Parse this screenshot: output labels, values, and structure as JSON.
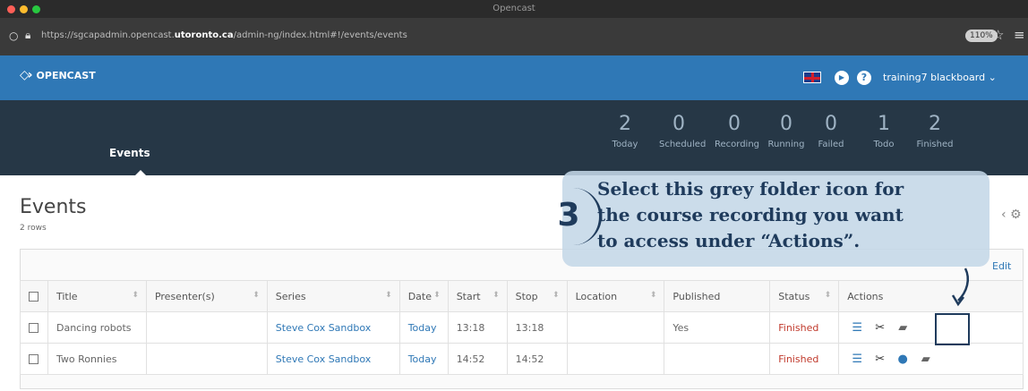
{
  "browser": {
    "window_title": "Opencast",
    "url_prefix": "https://sgcapadmin.opencast.",
    "url_domain": "utoronto.ca",
    "url_suffix": "/admin-ng/index.html#!/events/events",
    "zoom": "110%"
  },
  "header": {
    "logo_text": "OPENCAST",
    "user": "training7 blackboard ⌄"
  },
  "nav": {
    "active_tab": "Events"
  },
  "stats": [
    {
      "value": "2",
      "label": "Today"
    },
    {
      "value": "0",
      "label": "Scheduled"
    },
    {
      "value": "0",
      "label": "Recording"
    },
    {
      "value": "0",
      "label": "Running"
    },
    {
      "value": "0",
      "label": "Failed"
    },
    {
      "value": "1",
      "label": "Todo"
    },
    {
      "value": "2",
      "label": "Finished"
    }
  ],
  "page": {
    "title": "Events",
    "row_count": "2 rows",
    "edit_label": "Edit"
  },
  "table": {
    "columns": [
      "Title",
      "Presenter(s)",
      "Series",
      "Date",
      "Start",
      "Stop",
      "Location",
      "Published",
      "Status",
      "Actions"
    ],
    "rows": [
      {
        "title": "Dancing robots",
        "presenters": "",
        "series": "Steve Cox Sandbox",
        "date": "Today",
        "start": "13:18",
        "stop": "13:18",
        "location": "",
        "published": "Yes",
        "status": "Finished"
      },
      {
        "title": "Two Ronnies",
        "presenters": "",
        "series": "Steve Cox Sandbox",
        "date": "Today",
        "start": "14:52",
        "stop": "14:52",
        "location": "",
        "published": "",
        "status": "Finished"
      }
    ]
  },
  "annotation": {
    "step": "3",
    "line1": "Select this grey folder icon for",
    "line2": "the course recording you want",
    "line3": "to access under “Actions”."
  },
  "icons": {
    "row1_actions": [
      "details-icon",
      "scissors-icon",
      "folder-icon"
    ],
    "row2_actions": [
      "details-icon",
      "scissors-icon",
      "comment-icon",
      "folder-icon"
    ]
  },
  "colors": {
    "brand_blue": "#2f78b6",
    "header_dark": "#263746",
    "status_finished": "#c0392b",
    "annotation_navy": "#1f3b5c"
  }
}
